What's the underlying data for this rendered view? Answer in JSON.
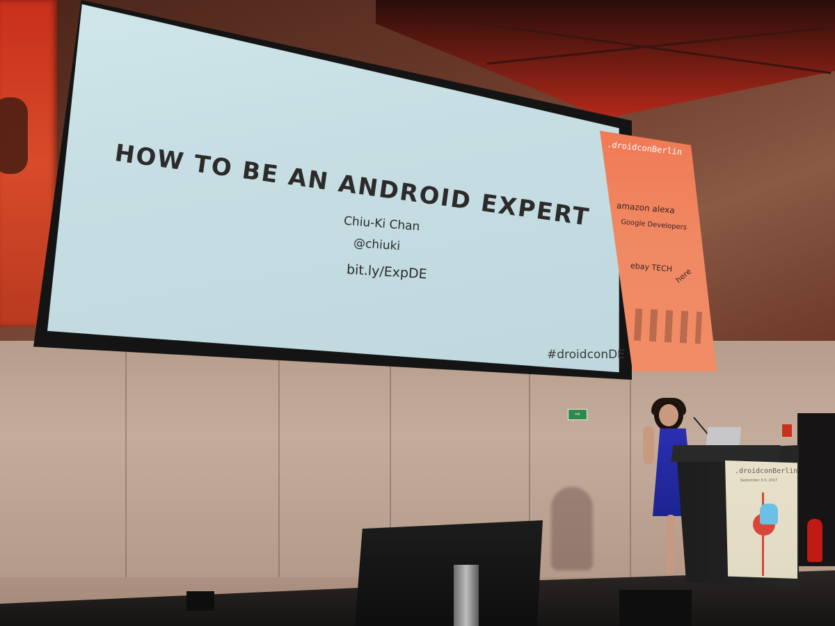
{
  "slide": {
    "title": "HOW TO BE AN ANDROID EXPERT",
    "author": "Chiu-Ki Chan",
    "handle": "@chiuki",
    "link": "bit.ly/ExpDE",
    "hashtag": "#droidconDE"
  },
  "sponsor_banner": {
    "brand": ".droidconBerlin",
    "sponsors": [
      "amazon alexa",
      "Google Developers",
      "ebay TECH",
      "here"
    ]
  },
  "exit_sign": "⇨",
  "podium": {
    "brand": ".droidconBerlin",
    "date": "September 3-5, 2017"
  },
  "colors": {
    "stage_red": "#c8301c",
    "screen": "#c6dee3",
    "slide_text": "#2d2a2a",
    "speaker_dress": "#2a2fb0"
  }
}
